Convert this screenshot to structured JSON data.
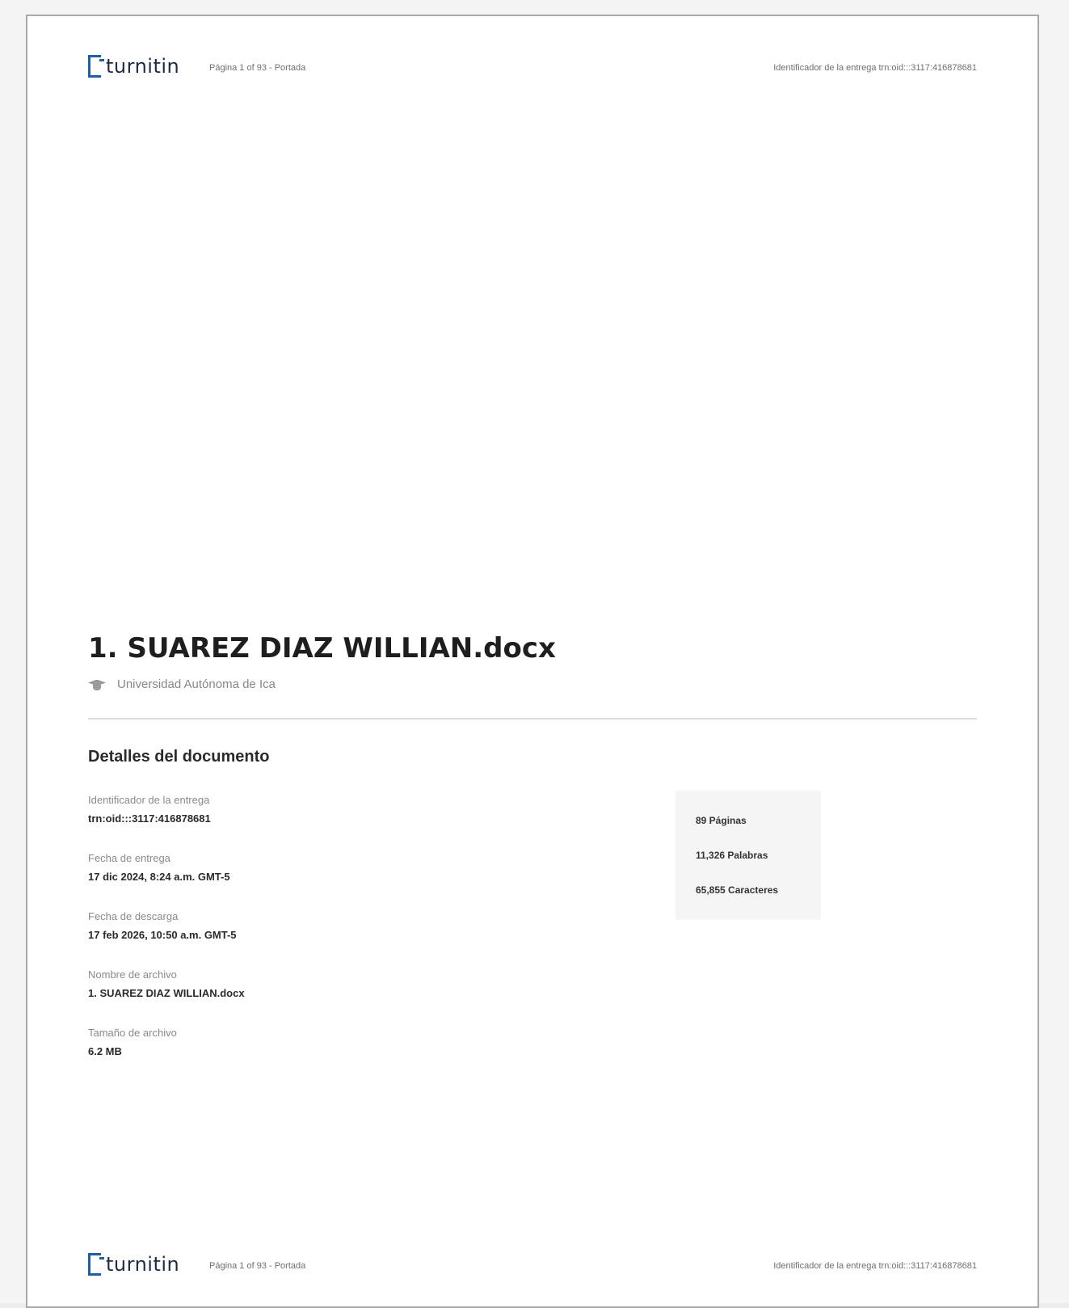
{
  "header": {
    "logo_text": "turnitin",
    "page_label": "Página 1 of 93 - Portada",
    "submission_id": "Identificador de la entrega trn:oid:::3117:416878681"
  },
  "document": {
    "title": "1. SUAREZ DIAZ WILLIAN.docx",
    "institution": "Universidad Autónoma de Ica"
  },
  "details": {
    "section_title": "Detalles del documento",
    "fields": [
      {
        "label": "Identificador de la entrega",
        "value": "trn:oid:::3117:416878681"
      },
      {
        "label": "Fecha de entrega",
        "value": "17 dic 2024, 8:24 a.m. GMT-5"
      },
      {
        "label": "Fecha de descarga",
        "value": "17 feb 2026, 10:50 a.m. GMT-5"
      },
      {
        "label": "Nombre de archivo",
        "value": "1. SUAREZ DIAZ WILLIAN.docx"
      },
      {
        "label": "Tamaño de archivo",
        "value": "6.2 MB"
      }
    ]
  },
  "stats": {
    "pages": "89 Páginas",
    "words": "11,326 Palabras",
    "characters": "65,855 Caracteres"
  },
  "footer": {
    "logo_text": "turnitin",
    "page_label": "Página 1 of 93 - Portada",
    "submission_id": "Identificador de la entrega trn:oid:::3117:416878681"
  }
}
